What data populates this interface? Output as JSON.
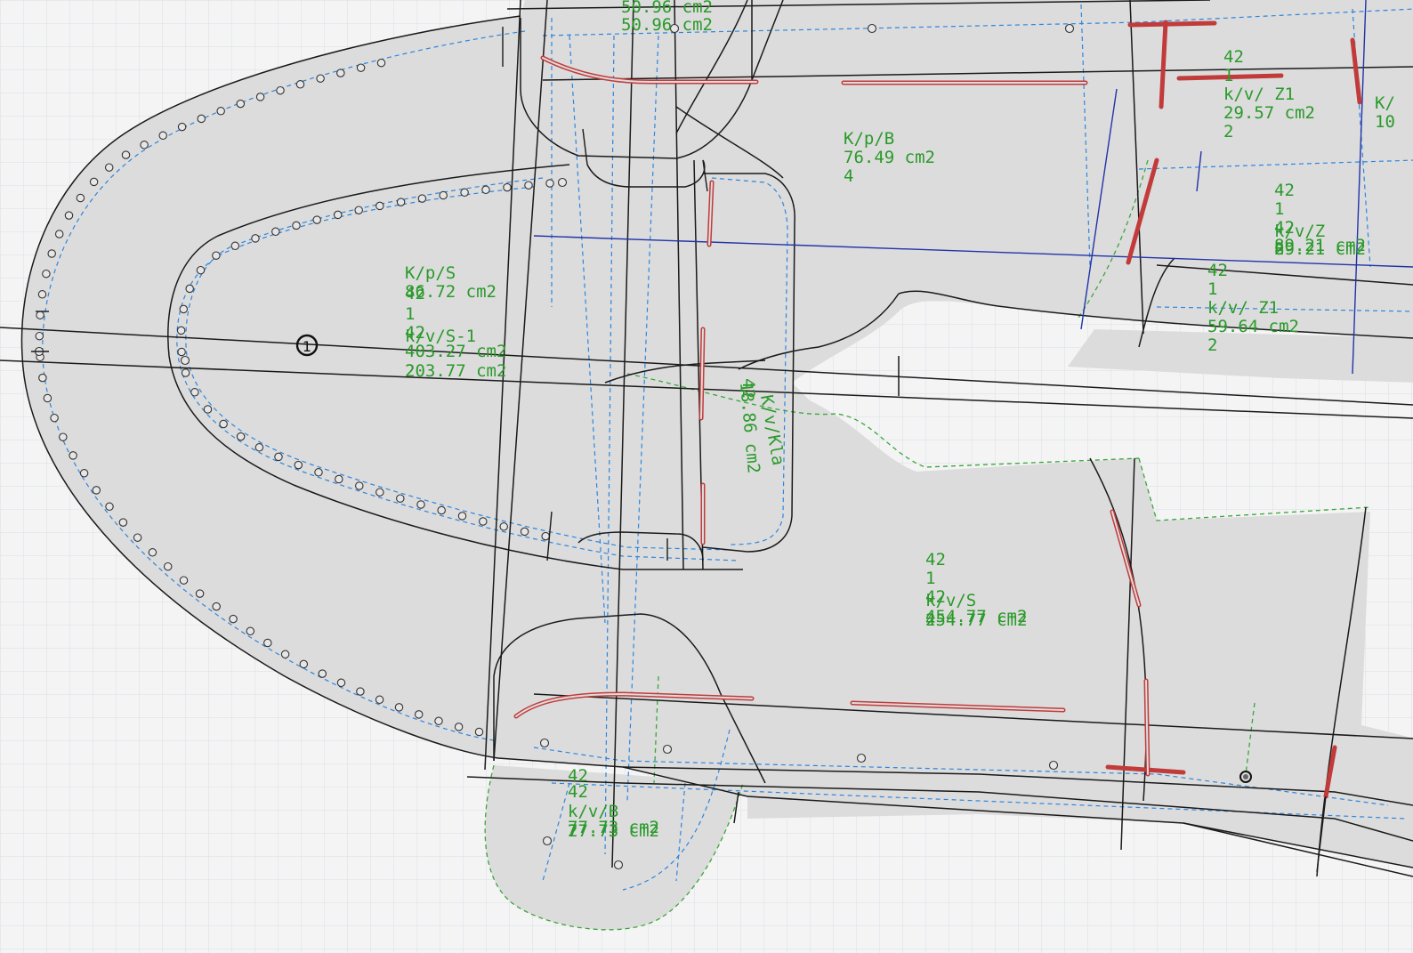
{
  "colors": {
    "background": "#f4f4f4",
    "grid": "#d9dee6",
    "piece_fill": "#dcdcdc",
    "outline": "#1a1a1a",
    "seam_dashed": "#2e86de",
    "green_dashed": "#3aa63a",
    "label_text": "#2a9a2a",
    "red_slot": "#c23b3b",
    "blue_line": "#2233aa"
  },
  "markers": {
    "reference_number": "1"
  },
  "labels": [
    {
      "name": "piece-label-k-p-b",
      "lines": [
        "K/p/B",
        "76.49 cm2",
        "4"
      ]
    },
    {
      "name": "piece-label-k-p-s",
      "lines": [
        "K/p/S",
        "86.72 cm2",
        "42",
        "1",
        "42",
        "k/v/S-1",
        "403.27 cm2",
        "2",
        "203.77 cm2"
      ]
    },
    {
      "name": "piece-label-k-v-kla",
      "lines": [
        "K/v/Kla",
        "18.86 cm2",
        "42"
      ]
    },
    {
      "name": "piece-label-k-v-s",
      "lines": [
        "42",
        "1",
        "42",
        "k/v/S",
        "454.77 cm2",
        "454.77 cm2",
        "2"
      ]
    },
    {
      "name": "piece-label-k-v-z1-upper",
      "lines": [
        "42",
        "1",
        "k/v/ Z1",
        "29.57 cm2",
        "2"
      ]
    },
    {
      "name": "piece-label-k-v-z",
      "lines": [
        "42",
        "1",
        "42",
        "k/v/Z",
        "89.21 cm2",
        "89.21 cm2",
        "2"
      ]
    },
    {
      "name": "piece-label-k-v-z1-lower",
      "lines": [
        "42",
        "1",
        "k/v/ Z1",
        "59.64 cm2",
        "2"
      ]
    },
    {
      "name": "piece-label-top",
      "lines": [
        "50.96 cm2",
        "50.96 cm2"
      ]
    },
    {
      "name": "piece-label-k-v-b",
      "lines": [
        "42",
        "42",
        "k/v/B",
        "77.73 cm2",
        "77.73 cm2",
        "2"
      ]
    },
    {
      "name": "piece-label-edge",
      "lines": [
        "K/",
        "10"
      ]
    }
  ]
}
